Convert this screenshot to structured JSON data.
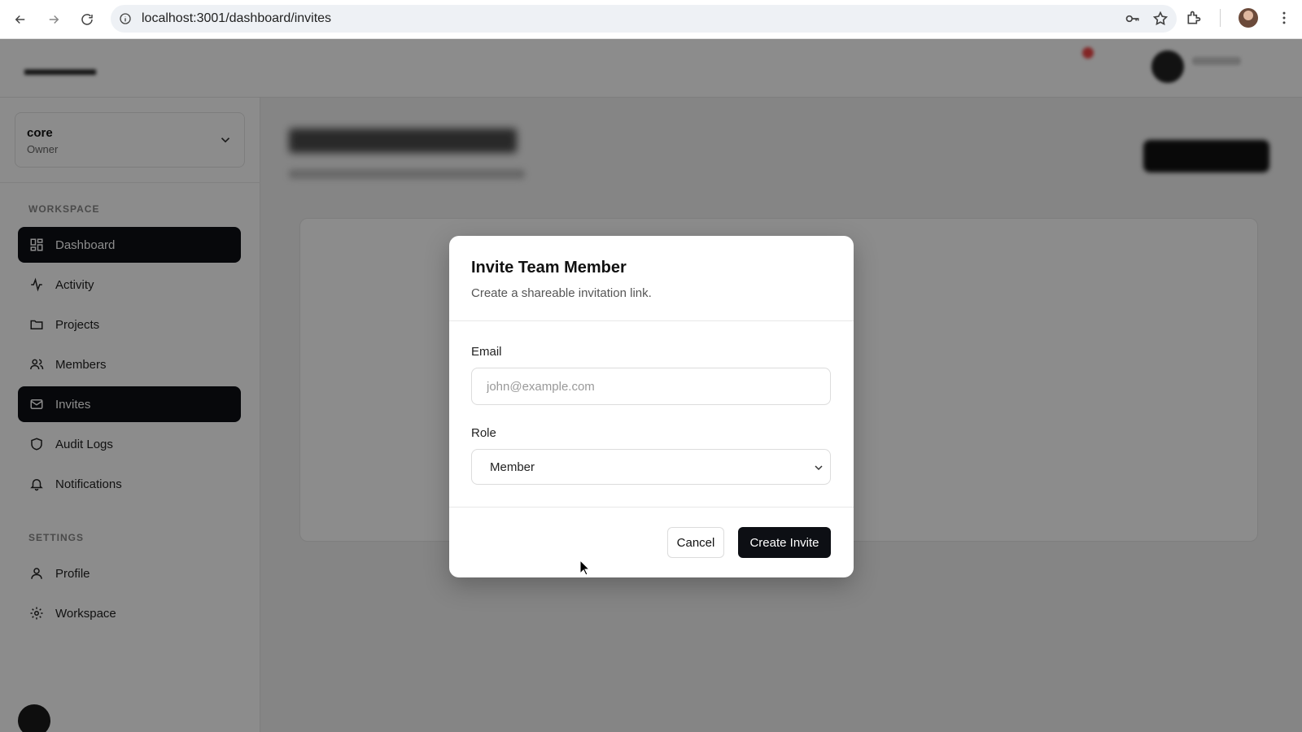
{
  "browser": {
    "url": "localhost:3001/dashboard/invites"
  },
  "workspace_switcher": {
    "name": "core",
    "role": "Owner"
  },
  "sidebar": {
    "workspace_section_title": "WORKSPACE",
    "workspace_items": [
      {
        "label": "Dashboard",
        "icon": "dashboard-icon",
        "active": true
      },
      {
        "label": "Activity",
        "icon": "activity-icon",
        "active": false
      },
      {
        "label": "Projects",
        "icon": "folder-icon",
        "active": false
      },
      {
        "label": "Members",
        "icon": "users-icon",
        "active": false
      },
      {
        "label": "Invites",
        "icon": "mail-icon",
        "active": true
      },
      {
        "label": "Audit Logs",
        "icon": "shield-icon",
        "active": false
      },
      {
        "label": "Notifications",
        "icon": "bell-icon",
        "active": false
      }
    ],
    "settings_section_title": "SETTINGS",
    "settings_items": [
      {
        "label": "Profile",
        "icon": "user-icon"
      },
      {
        "label": "Workspace",
        "icon": "gear-icon"
      }
    ]
  },
  "modal": {
    "title": "Invite Team Member",
    "description": "Create a shareable invitation link.",
    "email_label": "Email",
    "email_placeholder": "john@example.com",
    "email_value": "",
    "role_label": "Role",
    "role_value": "Member",
    "cancel_label": "Cancel",
    "create_label": "Create Invite"
  },
  "colors": {
    "active_nav_bg": "#0d0f14",
    "primary_button_bg": "#0d0f14",
    "overlay": "rgba(0,0,0,0.45)"
  }
}
